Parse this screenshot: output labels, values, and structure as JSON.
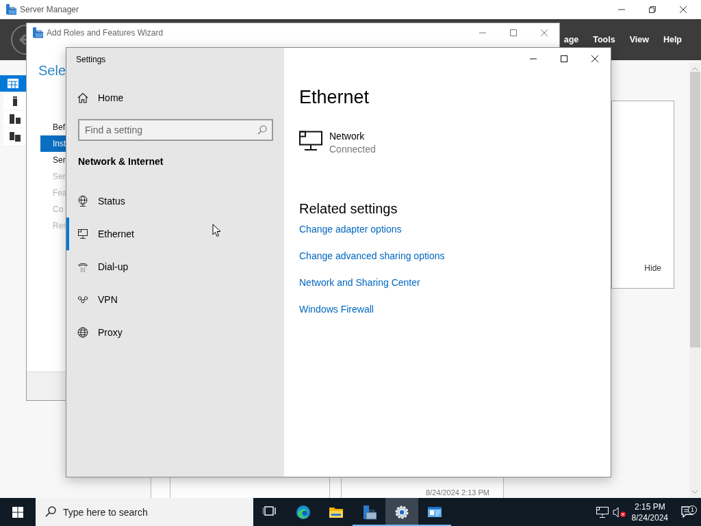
{
  "server_manager": {
    "title": "Server Manager",
    "menu": [
      "age",
      "Tools",
      "View",
      "Help"
    ],
    "nav_items": [
      {
        "kind": "dashboard",
        "selected": true
      },
      {
        "kind": "server",
        "selected": false
      },
      {
        "kind": "servers",
        "selected": false
      },
      {
        "kind": "files",
        "selected": false
      }
    ],
    "panel_button": "Hide",
    "timestamp": "8/24/2024 2:13 PM"
  },
  "wizard": {
    "title": "Add Roles and Features Wizard",
    "heading": "Sele",
    "steps": [
      {
        "label": "Bef",
        "selected": false,
        "disabled": false
      },
      {
        "label": "Inst",
        "selected": true,
        "disabled": false
      },
      {
        "label": "Ser",
        "selected": false,
        "disabled": false
      },
      {
        "label": "Ser",
        "selected": false,
        "disabled": true
      },
      {
        "label": "Fea",
        "selected": false,
        "disabled": true
      },
      {
        "label": "Co",
        "selected": false,
        "disabled": true
      },
      {
        "label": "Res",
        "selected": false,
        "disabled": true
      }
    ]
  },
  "settings": {
    "title": "Settings",
    "home": "Home",
    "search": {
      "placeholder": "Find a setting"
    },
    "section": "Network & Internet",
    "nav": [
      {
        "kind": "status",
        "label": "Status",
        "selected": false
      },
      {
        "kind": "ethernet",
        "label": "Ethernet",
        "selected": true
      },
      {
        "kind": "dialup",
        "label": "Dial-up",
        "selected": false
      },
      {
        "kind": "vpn",
        "label": "VPN",
        "selected": false
      },
      {
        "kind": "proxy",
        "label": "Proxy",
        "selected": false
      }
    ],
    "page_title": "Ethernet",
    "connection": {
      "name": "Network",
      "status": "Connected"
    },
    "related_title": "Related settings",
    "links": [
      "Change adapter options",
      "Change advanced sharing options",
      "Network and Sharing Center",
      "Windows Firewall"
    ]
  },
  "taskbar": {
    "search": {
      "placeholder": "Type here to search"
    },
    "apps": [
      {
        "kind": "task-view",
        "selected": false,
        "running": false
      },
      {
        "kind": "edge",
        "selected": false,
        "running": false
      },
      {
        "kind": "explorer",
        "selected": false,
        "running": false
      },
      {
        "kind": "server-manager",
        "selected": false,
        "running": true
      },
      {
        "kind": "settings",
        "selected": true,
        "running": true
      },
      {
        "kind": "control",
        "selected": false,
        "running": true
      }
    ],
    "time": "2:15 PM",
    "date": "8/24/2024",
    "notification_count": "1"
  }
}
